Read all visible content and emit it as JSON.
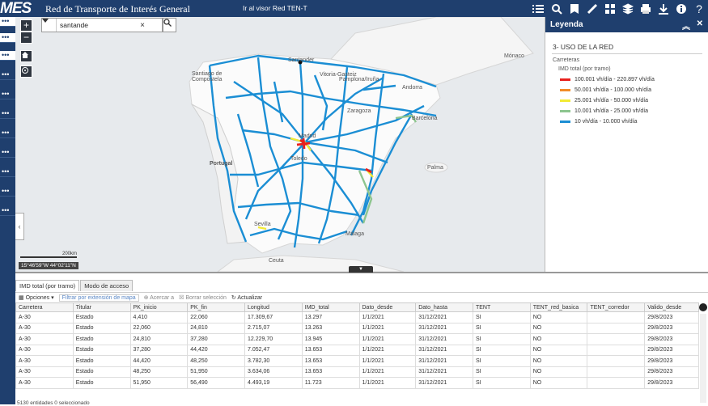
{
  "header": {
    "logo": "MES",
    "title": "Red de Transporte de Interés General",
    "tent_link": "Ir al visor Red TEN-T",
    "toolbar_icons": [
      "list-icon",
      "search-map-icon",
      "bookmark-icon",
      "measure-icon",
      "basemap-icon",
      "layers-icon",
      "print-icon",
      "download-icon",
      "info-icon",
      "help-icon"
    ]
  },
  "left_strip": [
    "•••",
    "•••",
    "•••",
    "•••",
    "•••",
    "•••",
    "•••",
    "•••",
    "•••",
    "•••",
    "•••"
  ],
  "search": {
    "value": "santande"
  },
  "map": {
    "labels": [
      "Santander",
      "Santiago de Compostela",
      "Vitoria-Gasteiz",
      "Pamplona/Iruña",
      "Andorra",
      "Mónaco",
      "Zaragoza",
      "Barcelona",
      "Portugal",
      "Toledo",
      "Palma",
      "Sevilla",
      "Málaga",
      "Ceuta",
      "Madrid"
    ],
    "scale_label": "200km",
    "coordinates": "15°46'59\"W 44°02'11\"N"
  },
  "legend": {
    "title": "Leyenda",
    "section": "3- USO DE LA RED",
    "layer": "Carreteras",
    "sublayer": "IMD total (por tramo)",
    "items": [
      {
        "label": "100.001 vh/día - 220.897 vh/día",
        "color": "#e8211d"
      },
      {
        "label": "50.001 vh/día - 100.000 vh/día",
        "color": "#f28c28"
      },
      {
        "label": "25.001 vh/día - 50.000 vh/día",
        "color": "#f2ea34"
      },
      {
        "label": "10.001 vh/día - 25.000 vh/día",
        "color": "#8dc58f"
      },
      {
        "label": "10 vh/día - 10.000 vh/día",
        "color": "#1b8ed4"
      }
    ]
  },
  "table_panel": {
    "tabs": [
      "IMD total (por tramo)",
      "Modo de acceso"
    ],
    "options": "Opciones",
    "filter": "Filtrar por extensión de mapa",
    "zoom": "Acercar a",
    "clear": "Borrar selección",
    "refresh": "Actualizar",
    "columns": [
      "Carretera",
      "Titular",
      "PK_inicio",
      "PK_fin",
      "Longitud",
      "IMD_total",
      "Dato_desde",
      "Dato_hasta",
      "TENT",
      "TENT_red_basica",
      "TENT_corredor",
      "Valido_desde"
    ],
    "rows": [
      [
        "A-30",
        "Estado",
        "4,410",
        "22,060",
        "17.309,67",
        "13.297",
        "1/1/2021",
        "31/12/2021",
        "SI",
        "NO",
        "",
        "29/8/2023"
      ],
      [
        "A-30",
        "Estado",
        "22,060",
        "24,810",
        "2.715,07",
        "13.263",
        "1/1/2021",
        "31/12/2021",
        "SI",
        "NO",
        "",
        "29/8/2023"
      ],
      [
        "A-30",
        "Estado",
        "24,810",
        "37,280",
        "12.229,70",
        "13.945",
        "1/1/2021",
        "31/12/2021",
        "SI",
        "NO",
        "",
        "29/8/2023"
      ],
      [
        "A-30",
        "Estado",
        "37,280",
        "44,420",
        "7.052,47",
        "13.653",
        "1/1/2021",
        "31/12/2021",
        "SI",
        "NO",
        "",
        "29/8/2023"
      ],
      [
        "A-30",
        "Estado",
        "44,420",
        "48,250",
        "3.782,30",
        "13.653",
        "1/1/2021",
        "31/12/2021",
        "SI",
        "NO",
        "",
        "29/8/2023"
      ],
      [
        "A-30",
        "Estado",
        "48,250",
        "51,950",
        "3.634,06",
        "13.653",
        "1/1/2021",
        "31/12/2021",
        "SI",
        "NO",
        "",
        "29/8/2023"
      ],
      [
        "A-30",
        "Estado",
        "51,950",
        "56,490",
        "4.493,19",
        "11.723",
        "1/1/2021",
        "31/12/2021",
        "SI",
        "NO",
        "",
        "29/8/2023"
      ]
    ],
    "footer": "5130 entidades 0 seleccionado"
  }
}
